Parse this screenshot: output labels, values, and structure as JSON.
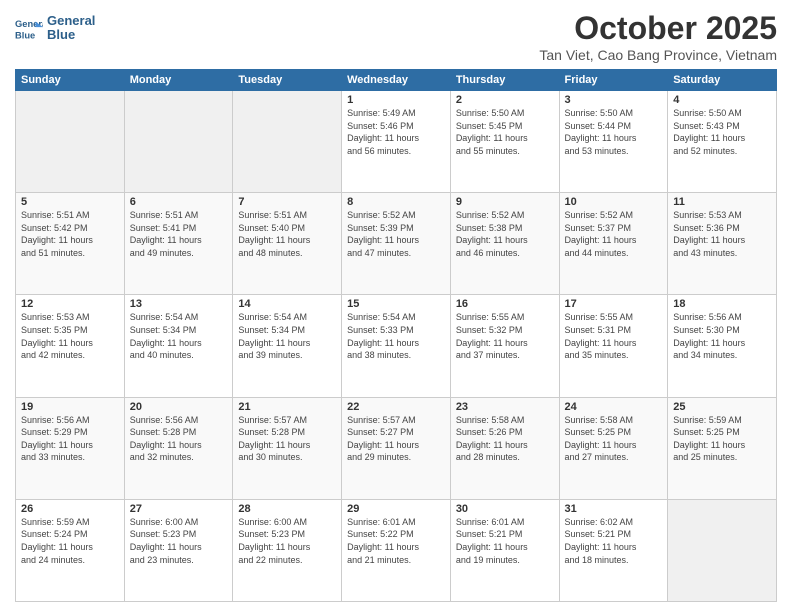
{
  "header": {
    "logo_line1": "General",
    "logo_line2": "Blue",
    "title": "October 2025",
    "subtitle": "Tan Viet, Cao Bang Province, Vietnam"
  },
  "days_of_week": [
    "Sunday",
    "Monday",
    "Tuesday",
    "Wednesday",
    "Thursday",
    "Friday",
    "Saturday"
  ],
  "weeks": [
    [
      {
        "num": "",
        "info": ""
      },
      {
        "num": "",
        "info": ""
      },
      {
        "num": "",
        "info": ""
      },
      {
        "num": "1",
        "info": "Sunrise: 5:49 AM\nSunset: 5:46 PM\nDaylight: 11 hours\nand 56 minutes."
      },
      {
        "num": "2",
        "info": "Sunrise: 5:50 AM\nSunset: 5:45 PM\nDaylight: 11 hours\nand 55 minutes."
      },
      {
        "num": "3",
        "info": "Sunrise: 5:50 AM\nSunset: 5:44 PM\nDaylight: 11 hours\nand 53 minutes."
      },
      {
        "num": "4",
        "info": "Sunrise: 5:50 AM\nSunset: 5:43 PM\nDaylight: 11 hours\nand 52 minutes."
      }
    ],
    [
      {
        "num": "5",
        "info": "Sunrise: 5:51 AM\nSunset: 5:42 PM\nDaylight: 11 hours\nand 51 minutes."
      },
      {
        "num": "6",
        "info": "Sunrise: 5:51 AM\nSunset: 5:41 PM\nDaylight: 11 hours\nand 49 minutes."
      },
      {
        "num": "7",
        "info": "Sunrise: 5:51 AM\nSunset: 5:40 PM\nDaylight: 11 hours\nand 48 minutes."
      },
      {
        "num": "8",
        "info": "Sunrise: 5:52 AM\nSunset: 5:39 PM\nDaylight: 11 hours\nand 47 minutes."
      },
      {
        "num": "9",
        "info": "Sunrise: 5:52 AM\nSunset: 5:38 PM\nDaylight: 11 hours\nand 46 minutes."
      },
      {
        "num": "10",
        "info": "Sunrise: 5:52 AM\nSunset: 5:37 PM\nDaylight: 11 hours\nand 44 minutes."
      },
      {
        "num": "11",
        "info": "Sunrise: 5:53 AM\nSunset: 5:36 PM\nDaylight: 11 hours\nand 43 minutes."
      }
    ],
    [
      {
        "num": "12",
        "info": "Sunrise: 5:53 AM\nSunset: 5:35 PM\nDaylight: 11 hours\nand 42 minutes."
      },
      {
        "num": "13",
        "info": "Sunrise: 5:54 AM\nSunset: 5:34 PM\nDaylight: 11 hours\nand 40 minutes."
      },
      {
        "num": "14",
        "info": "Sunrise: 5:54 AM\nSunset: 5:34 PM\nDaylight: 11 hours\nand 39 minutes."
      },
      {
        "num": "15",
        "info": "Sunrise: 5:54 AM\nSunset: 5:33 PM\nDaylight: 11 hours\nand 38 minutes."
      },
      {
        "num": "16",
        "info": "Sunrise: 5:55 AM\nSunset: 5:32 PM\nDaylight: 11 hours\nand 37 minutes."
      },
      {
        "num": "17",
        "info": "Sunrise: 5:55 AM\nSunset: 5:31 PM\nDaylight: 11 hours\nand 35 minutes."
      },
      {
        "num": "18",
        "info": "Sunrise: 5:56 AM\nSunset: 5:30 PM\nDaylight: 11 hours\nand 34 minutes."
      }
    ],
    [
      {
        "num": "19",
        "info": "Sunrise: 5:56 AM\nSunset: 5:29 PM\nDaylight: 11 hours\nand 33 minutes."
      },
      {
        "num": "20",
        "info": "Sunrise: 5:56 AM\nSunset: 5:28 PM\nDaylight: 11 hours\nand 32 minutes."
      },
      {
        "num": "21",
        "info": "Sunrise: 5:57 AM\nSunset: 5:28 PM\nDaylight: 11 hours\nand 30 minutes."
      },
      {
        "num": "22",
        "info": "Sunrise: 5:57 AM\nSunset: 5:27 PM\nDaylight: 11 hours\nand 29 minutes."
      },
      {
        "num": "23",
        "info": "Sunrise: 5:58 AM\nSunset: 5:26 PM\nDaylight: 11 hours\nand 28 minutes."
      },
      {
        "num": "24",
        "info": "Sunrise: 5:58 AM\nSunset: 5:25 PM\nDaylight: 11 hours\nand 27 minutes."
      },
      {
        "num": "25",
        "info": "Sunrise: 5:59 AM\nSunset: 5:25 PM\nDaylight: 11 hours\nand 25 minutes."
      }
    ],
    [
      {
        "num": "26",
        "info": "Sunrise: 5:59 AM\nSunset: 5:24 PM\nDaylight: 11 hours\nand 24 minutes."
      },
      {
        "num": "27",
        "info": "Sunrise: 6:00 AM\nSunset: 5:23 PM\nDaylight: 11 hours\nand 23 minutes."
      },
      {
        "num": "28",
        "info": "Sunrise: 6:00 AM\nSunset: 5:23 PM\nDaylight: 11 hours\nand 22 minutes."
      },
      {
        "num": "29",
        "info": "Sunrise: 6:01 AM\nSunset: 5:22 PM\nDaylight: 11 hours\nand 21 minutes."
      },
      {
        "num": "30",
        "info": "Sunrise: 6:01 AM\nSunset: 5:21 PM\nDaylight: 11 hours\nand 19 minutes."
      },
      {
        "num": "31",
        "info": "Sunrise: 6:02 AM\nSunset: 5:21 PM\nDaylight: 11 hours\nand 18 minutes."
      },
      {
        "num": "",
        "info": ""
      }
    ]
  ]
}
